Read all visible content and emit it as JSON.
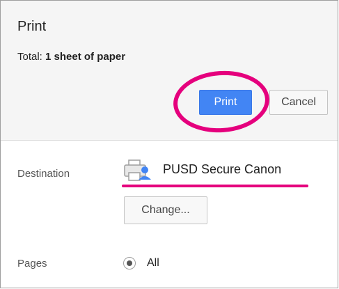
{
  "dialog": {
    "title": "Print",
    "total_prefix": "Total: ",
    "total_value": "1 sheet of paper",
    "print_label": "Print",
    "cancel_label": "Cancel"
  },
  "destination": {
    "label": "Destination",
    "printer_name": "PUSD Secure Canon",
    "change_label": "Change..."
  },
  "pages": {
    "label": "Pages",
    "selected_option": "All"
  },
  "colors": {
    "accent": "#4285f4",
    "annotation": "#e5007d"
  }
}
